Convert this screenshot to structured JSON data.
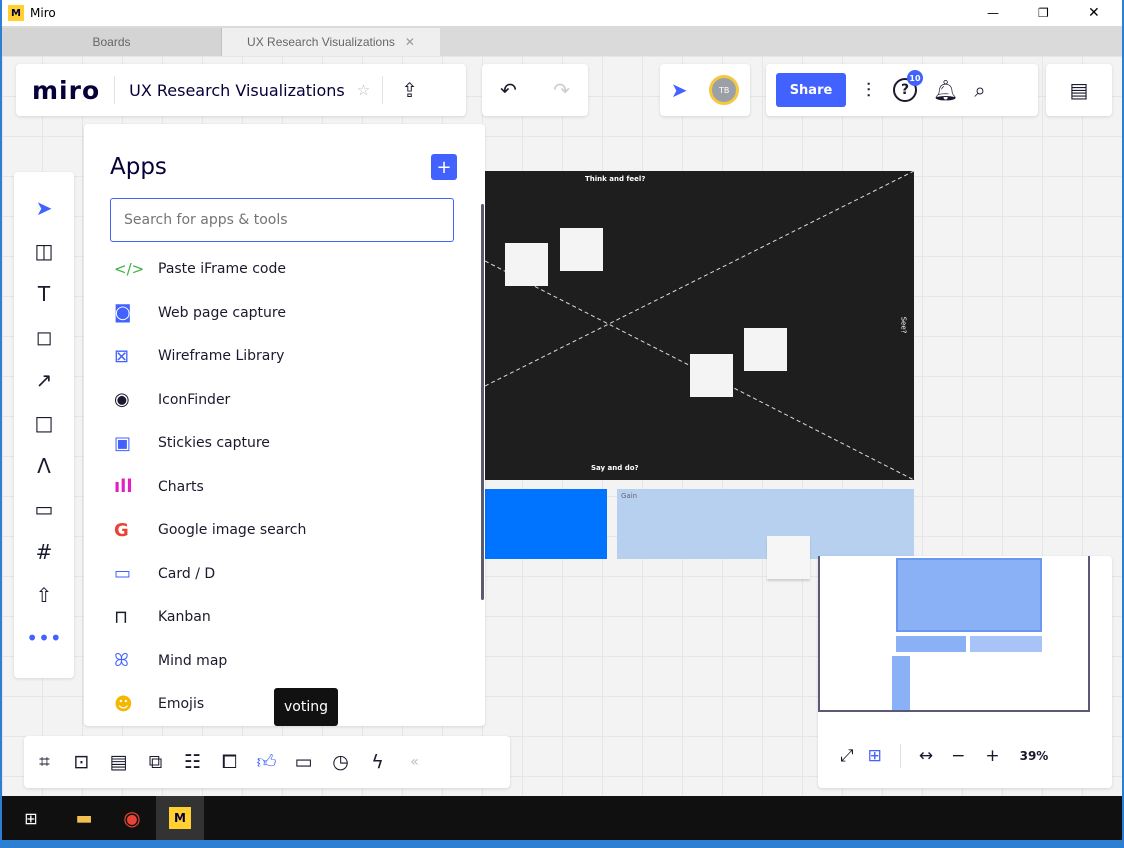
{
  "window": {
    "title": "Miro",
    "minimize": "—",
    "restore": "❐",
    "close": "✕"
  },
  "tabs": [
    {
      "label": "Boards"
    },
    {
      "label": "UX Research Visualizations",
      "close": "✕"
    }
  ],
  "header": {
    "logo": "miro",
    "board_title": "UX Research Visualizations",
    "avatar_initials": "TB",
    "share_label": "Share",
    "help_badge": "10"
  },
  "apps_panel": {
    "title": "Apps",
    "add_label": "+",
    "search_placeholder": "Search for apps & tools",
    "items": [
      {
        "label": "Paste iFrame code",
        "icon": "code-icon"
      },
      {
        "label": "Web page capture",
        "icon": "web-capture-icon"
      },
      {
        "label": "Wireframe Library",
        "icon": "wireframe-icon"
      },
      {
        "label": "IconFinder",
        "icon": "iconfinder-icon"
      },
      {
        "label": "Stickies capture",
        "icon": "stickies-capture-icon"
      },
      {
        "label": "Charts",
        "icon": "charts-icon"
      },
      {
        "label": "Google image search",
        "icon": "google-icon"
      },
      {
        "label": "Card / D",
        "icon": "card-icon"
      },
      {
        "label": "Kanban",
        "icon": "kanban-icon"
      },
      {
        "label": "Mind map",
        "icon": "mind-map-icon"
      },
      {
        "label": "Emojis",
        "icon": "emoji-icon"
      }
    ]
  },
  "board": {
    "top_label": "Think and feel?",
    "bottom_label": "Say and do?",
    "right_label": "See?",
    "gain_label": "Gain"
  },
  "tooltip": "voting",
  "minimap": {
    "zoom": "39%"
  },
  "colors": {
    "accent": "#4262ff",
    "board": "#1e1e1e",
    "blue": "#0073ff",
    "light_blue": "#b8d0f0"
  }
}
